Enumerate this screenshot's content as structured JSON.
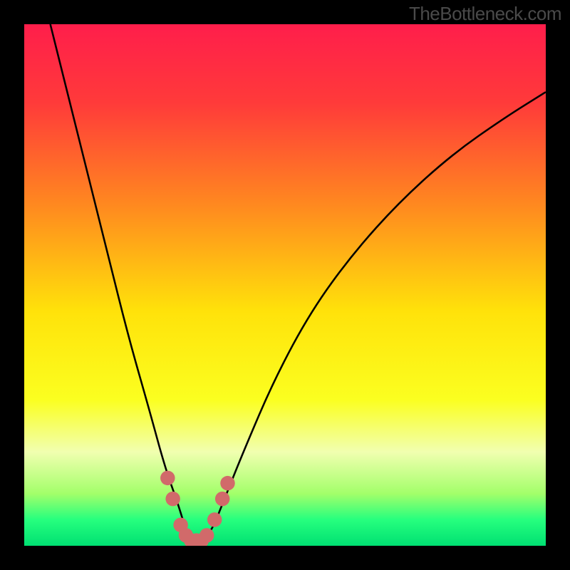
{
  "watermark": "TheBottleneck.com",
  "chart_data": {
    "type": "line",
    "title": "",
    "xlabel": "",
    "ylabel": "",
    "xlim": [
      0,
      100
    ],
    "ylim": [
      0,
      100
    ],
    "background_gradient": {
      "stops": [
        {
          "pos": 0.0,
          "color": "#ff1e4b"
        },
        {
          "pos": 0.15,
          "color": "#ff3a3a"
        },
        {
          "pos": 0.35,
          "color": "#ff8a1f"
        },
        {
          "pos": 0.55,
          "color": "#ffe20a"
        },
        {
          "pos": 0.72,
          "color": "#fbff20"
        },
        {
          "pos": 0.82,
          "color": "#f1ffb0"
        },
        {
          "pos": 0.9,
          "color": "#a3ff6a"
        },
        {
          "pos": 0.95,
          "color": "#26ff7e"
        },
        {
          "pos": 1.0,
          "color": "#00e072"
        }
      ]
    },
    "series": [
      {
        "name": "bottleneck-curve",
        "color": "#000000",
        "x": [
          5,
          8,
          12,
          16,
          20,
          24,
          27,
          29.5,
          31,
          32.5,
          34,
          36,
          38,
          42,
          48,
          55,
          63,
          72,
          82,
          92,
          100
        ],
        "y": [
          100,
          88,
          72,
          56,
          40,
          26,
          15,
          8,
          3,
          1,
          1,
          3,
          8,
          18,
          32,
          45,
          56,
          66,
          75,
          82,
          87
        ]
      }
    ],
    "markers": {
      "name": "highlight-dots",
      "color": "#d16a6a",
      "radius": 1.4,
      "points": [
        {
          "x": 27.5,
          "y": 13
        },
        {
          "x": 28.5,
          "y": 9
        },
        {
          "x": 30,
          "y": 4
        },
        {
          "x": 31,
          "y": 2
        },
        {
          "x": 32,
          "y": 1
        },
        {
          "x": 33,
          "y": 1
        },
        {
          "x": 34,
          "y": 1
        },
        {
          "x": 35,
          "y": 2
        },
        {
          "x": 36.5,
          "y": 5
        },
        {
          "x": 38,
          "y": 9
        },
        {
          "x": 39,
          "y": 12
        }
      ]
    }
  }
}
